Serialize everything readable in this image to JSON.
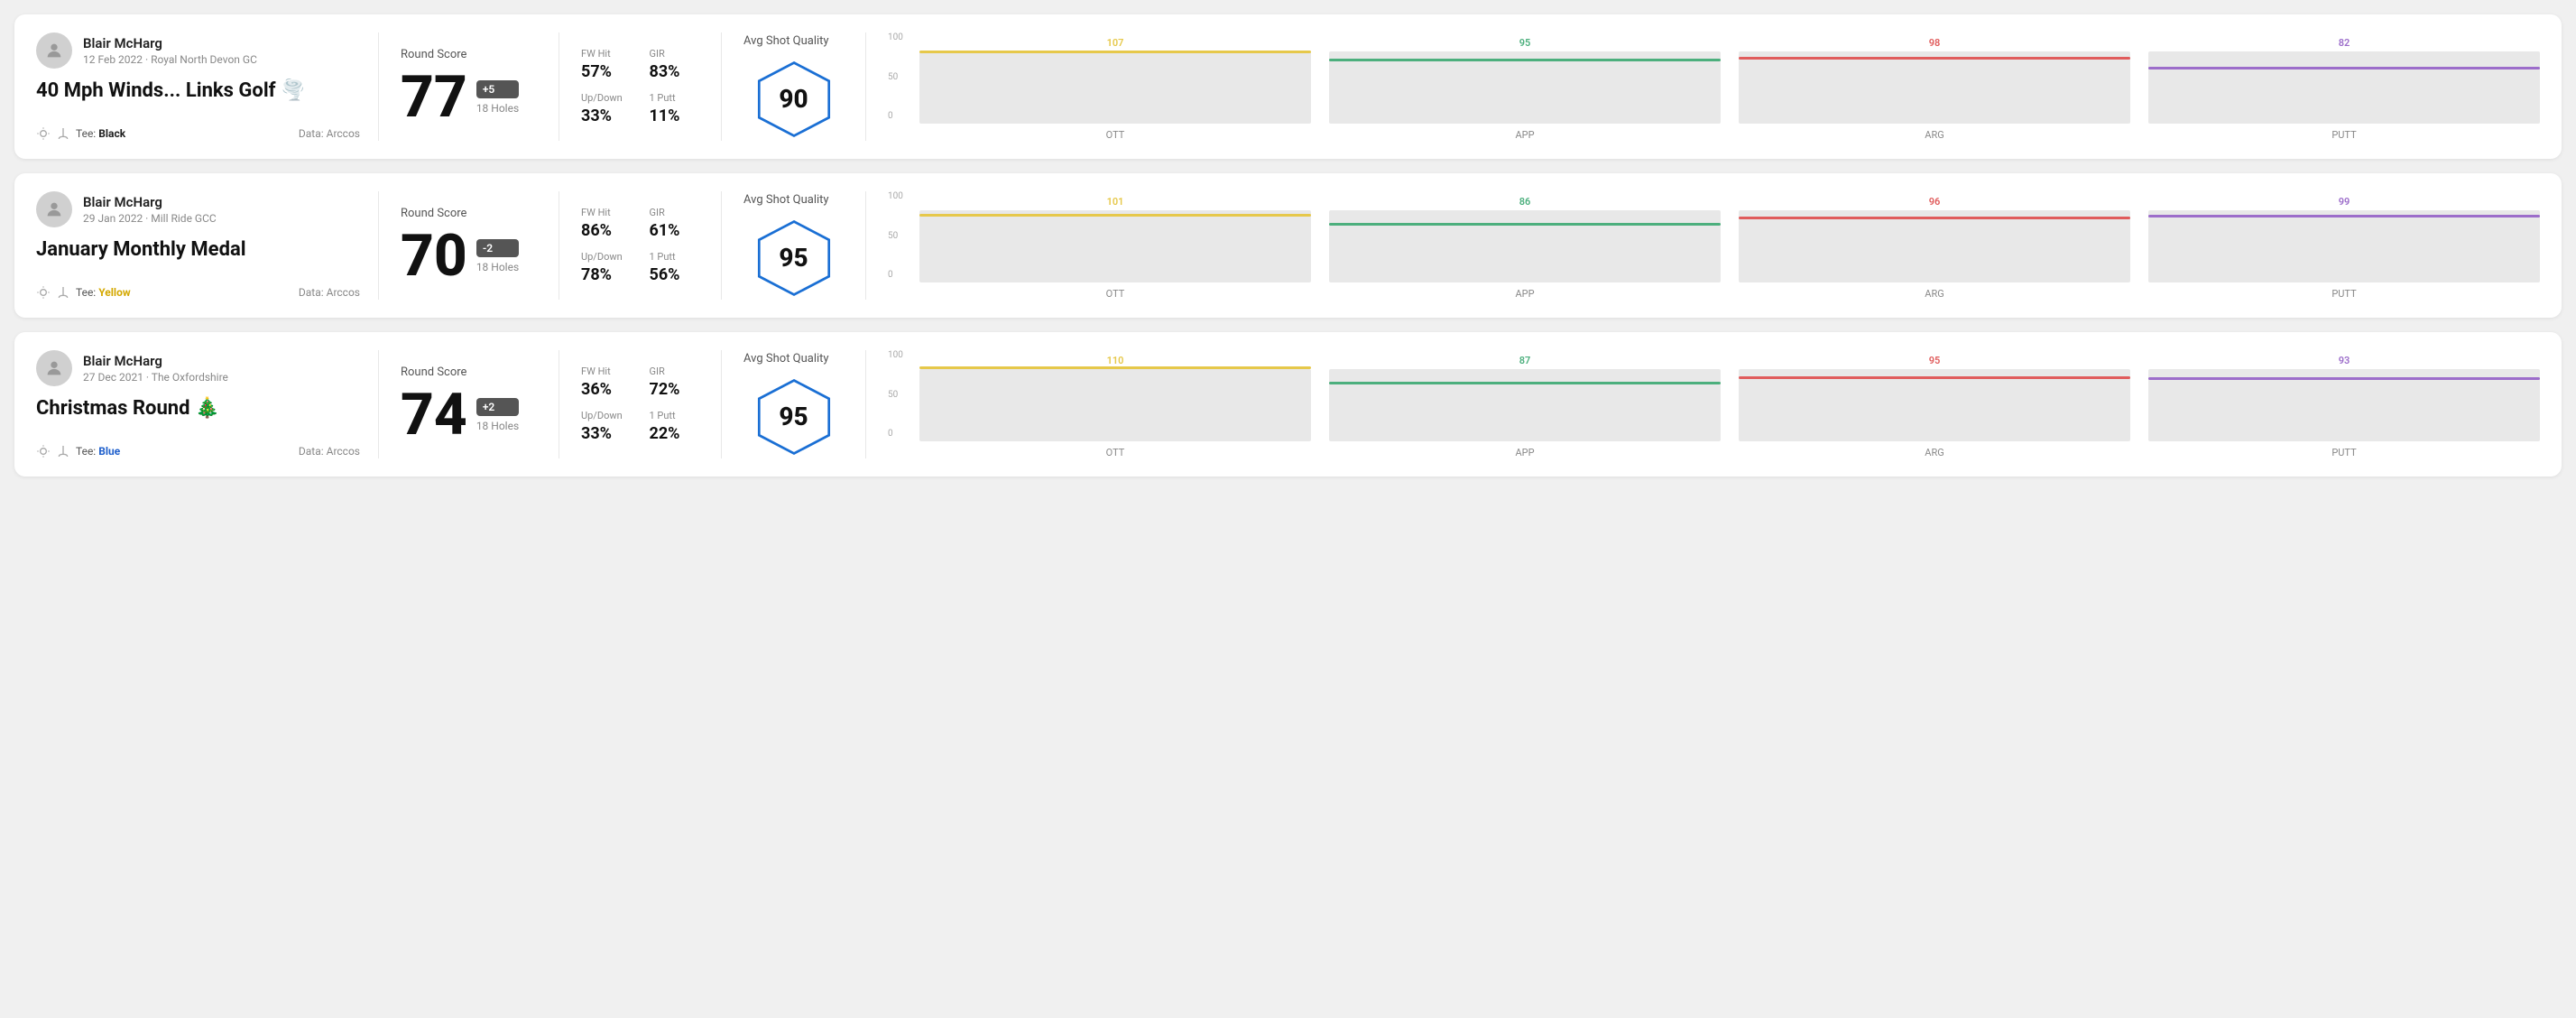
{
  "rounds": [
    {
      "id": "round-1",
      "user": {
        "name": "Blair McHarg",
        "date": "12 Feb 2022",
        "course": "Royal North Devon GC"
      },
      "title": "40 Mph Winds... Links Golf 🌪️",
      "tee": "Black",
      "data_source": "Data: Arccos",
      "score": {
        "label": "Round Score",
        "number": "77",
        "badge": "+5",
        "badge_type": "positive",
        "holes": "18 Holes"
      },
      "stats": {
        "fw_hit_label": "FW Hit",
        "fw_hit_value": "57%",
        "gir_label": "GIR",
        "gir_value": "83%",
        "updown_label": "Up/Down",
        "updown_value": "33%",
        "one_putt_label": "1 Putt",
        "one_putt_value": "11%"
      },
      "quality": {
        "label": "Avg Shot Quality",
        "score": "90"
      },
      "chart": {
        "y_labels": [
          "100",
          "50",
          "0"
        ],
        "columns": [
          {
            "label": "OTT",
            "value": 107,
            "color": "#e6c84a",
            "height_pct": 85
          },
          {
            "label": "APP",
            "value": 95,
            "color": "#4caf7d",
            "height_pct": 73
          },
          {
            "label": "ARG",
            "value": 98,
            "color": "#e05c5c",
            "height_pct": 76
          },
          {
            "label": "PUTT",
            "value": 82,
            "color": "#9c6dca",
            "height_pct": 63
          }
        ]
      }
    },
    {
      "id": "round-2",
      "user": {
        "name": "Blair McHarg",
        "date": "29 Jan 2022",
        "course": "Mill Ride GCC"
      },
      "title": "January Monthly Medal",
      "tee": "Yellow",
      "data_source": "Data: Arccos",
      "score": {
        "label": "Round Score",
        "number": "70",
        "badge": "-2",
        "badge_type": "negative",
        "holes": "18 Holes"
      },
      "stats": {
        "fw_hit_label": "FW Hit",
        "fw_hit_value": "86%",
        "gir_label": "GIR",
        "gir_value": "61%",
        "updown_label": "Up/Down",
        "updown_value": "78%",
        "one_putt_label": "1 Putt",
        "one_putt_value": "56%"
      },
      "quality": {
        "label": "Avg Shot Quality",
        "score": "95"
      },
      "chart": {
        "y_labels": [
          "100",
          "50",
          "0"
        ],
        "columns": [
          {
            "label": "OTT",
            "value": 101,
            "color": "#e6c84a",
            "height_pct": 80
          },
          {
            "label": "APP",
            "value": 86,
            "color": "#4caf7d",
            "height_pct": 66
          },
          {
            "label": "ARG",
            "value": 96,
            "color": "#e05c5c",
            "height_pct": 74
          },
          {
            "label": "PUTT",
            "value": 99,
            "color": "#9c6dca",
            "height_pct": 77
          }
        ]
      }
    },
    {
      "id": "round-3",
      "user": {
        "name": "Blair McHarg",
        "date": "27 Dec 2021",
        "course": "The Oxfordshire"
      },
      "title": "Christmas Round 🎄",
      "tee": "Blue",
      "data_source": "Data: Arccos",
      "score": {
        "label": "Round Score",
        "number": "74",
        "badge": "+2",
        "badge_type": "positive",
        "holes": "18 Holes"
      },
      "stats": {
        "fw_hit_label": "FW Hit",
        "fw_hit_value": "36%",
        "gir_label": "GIR",
        "gir_value": "72%",
        "updown_label": "Up/Down",
        "updown_value": "33%",
        "one_putt_label": "1 Putt",
        "one_putt_value": "22%"
      },
      "quality": {
        "label": "Avg Shot Quality",
        "score": "95"
      },
      "chart": {
        "y_labels": [
          "100",
          "50",
          "0"
        ],
        "columns": [
          {
            "label": "OTT",
            "value": 110,
            "color": "#e6c84a",
            "height_pct": 88
          },
          {
            "label": "APP",
            "value": 87,
            "color": "#4caf7d",
            "height_pct": 67
          },
          {
            "label": "ARG",
            "value": 95,
            "color": "#e05c5c",
            "height_pct": 73
          },
          {
            "label": "PUTT",
            "value": 93,
            "color": "#9c6dca",
            "height_pct": 72
          }
        ]
      }
    }
  ]
}
